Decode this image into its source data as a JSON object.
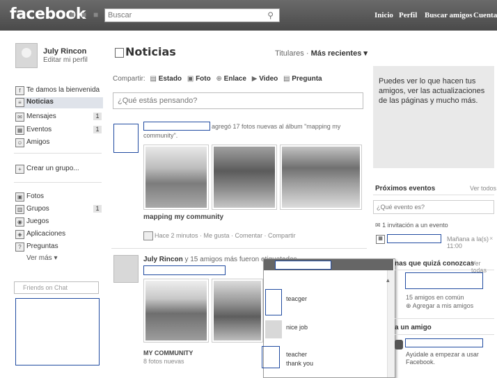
{
  "topbar": {
    "logo": "facebook",
    "search_placeholder": "Buscar",
    "nav": [
      "Inicio",
      "Perfil",
      "Buscar amigos",
      "Cuenta"
    ]
  },
  "profile": {
    "name": "July Rincon",
    "edit": "Editar mi perfil"
  },
  "sidebar": {
    "items": [
      {
        "label": "Te damos la bienvenida",
        "icon": "facebook-icon"
      },
      {
        "label": "Noticias",
        "icon": "news-icon"
      },
      {
        "label": "Mensajes",
        "icon": "message-icon",
        "count": "1"
      },
      {
        "label": "Eventos",
        "icon": "calendar-icon",
        "count": "1"
      },
      {
        "label": "Amigos",
        "icon": "friends-icon"
      }
    ],
    "create_group": "Crear un grupo...",
    "apps": [
      {
        "label": "Fotos",
        "icon": "photo-icon"
      },
      {
        "label": "Grupos",
        "icon": "group-icon",
        "count": "1"
      },
      {
        "label": "Juegos",
        "icon": "game-icon"
      },
      {
        "label": "Aplicaciones",
        "icon": "app-icon"
      },
      {
        "label": "Preguntas",
        "icon": "question-icon"
      }
    ],
    "more": "Ver más ▾",
    "chat_search": "Friends on Chat"
  },
  "feed": {
    "title": "Noticias",
    "sort_prefix": "Titulares ·",
    "sort_active": "Más recientes ▾",
    "share_label": "Compartir:",
    "share_options": [
      "Estado",
      "Foto",
      "Enlace",
      "Video",
      "Pregunta"
    ],
    "status_placeholder": "¿Qué estás pensando?",
    "post1": {
      "text": "agregó 17 fotos nuevas al álbum \"mapping my community\".",
      "album": "mapping my community",
      "meta": "Hace 2 minutos · Me gusta · Comentar · Compartir"
    },
    "post2": {
      "author": "July Rincon",
      "text": "y 15 amigos más fueron etiquetados",
      "album": "MY COMMUNITY",
      "count": "8 fotos nuevas"
    }
  },
  "popup": {
    "comments": [
      "teacger",
      "nice job",
      "teacher",
      "thank you"
    ]
  },
  "right": {
    "info": "Puedes ver lo que hacen tus amigos, ver las actualizaciones de las páginas y mucho más.",
    "events_title": "Próximos eventos",
    "events_link": "Ver todos",
    "event_placeholder": "¿Qué evento es?",
    "invite": "1 invitación a un evento",
    "event_time": "Mañana a la(s) 11:00",
    "people_title": "nas que quizá conozcas",
    "people_link": "Ver todas",
    "mutual": "15 amigos en común",
    "add_friend": "Agregar a mis amigos",
    "suggest_title": "a un amigo",
    "suggest_text": "Ayúdale a empezar a usar Facebook."
  }
}
